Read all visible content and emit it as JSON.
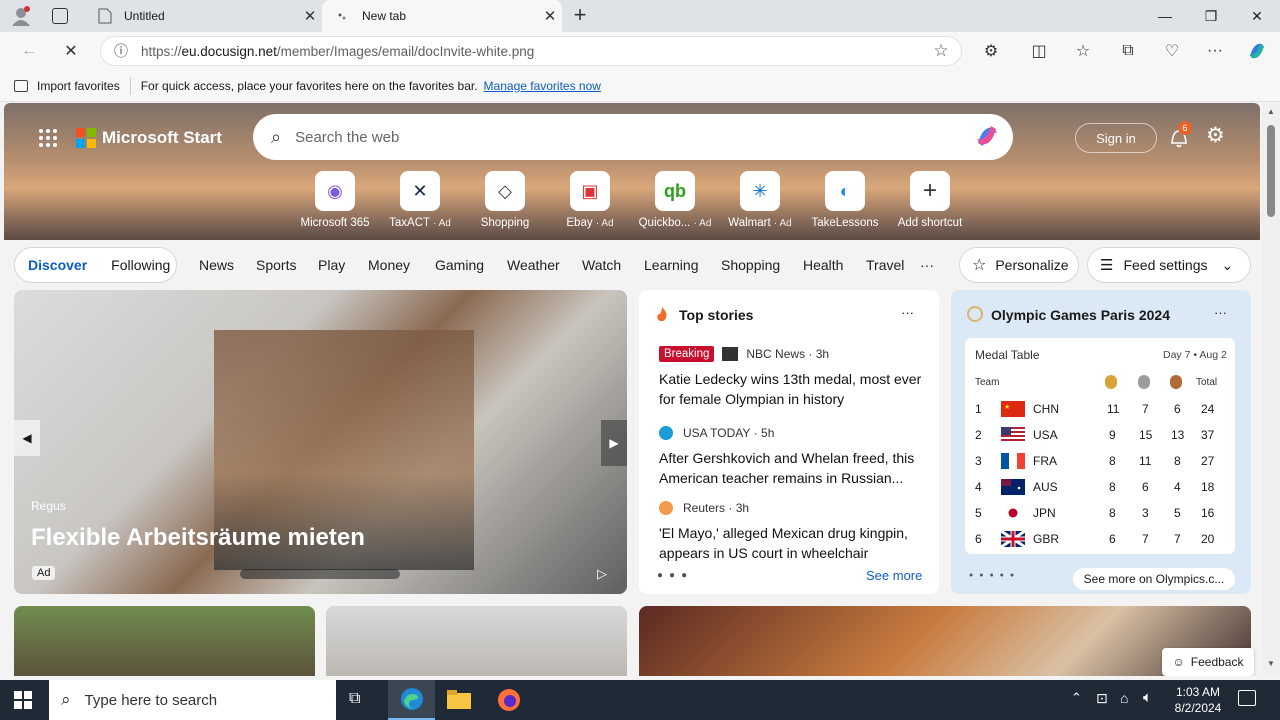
{
  "tabs": [
    {
      "label": "Untitled"
    },
    {
      "label": "New tab"
    }
  ],
  "address": {
    "host": "eu.docusign.net",
    "prefix": "https://",
    "path": "/member/Images/email/docInvite-white.png"
  },
  "favbar": {
    "import_label": "Import favorites",
    "hint": "For quick access, place your favorites here on the favorites bar.",
    "manage_link": "Manage favorites now"
  },
  "header": {
    "brand": "Microsoft Start",
    "search_placeholder": "Search the web",
    "sign_in": "Sign in",
    "notif_count": "6"
  },
  "shortcuts": [
    {
      "label": "Microsoft 365",
      "ad": "",
      "glyph": "◉",
      "color": "#7b5cd6"
    },
    {
      "label": "TaxACT",
      "ad": "· Ad",
      "glyph": "✕",
      "color": "#1b2a4a"
    },
    {
      "label": "Shopping",
      "ad": "",
      "glyph": "◇",
      "color": "#444"
    },
    {
      "label": "Ebay",
      "ad": "· Ad",
      "glyph": "▣",
      "color": "#e53238"
    },
    {
      "label": "Quickbo...",
      "ad": "· Ad",
      "glyph": "qb",
      "color": "#2ca01c"
    },
    {
      "label": "Walmart",
      "ad": "· Ad",
      "glyph": "✳",
      "color": "#0071dc"
    },
    {
      "label": "TakeLessons",
      "ad": "",
      "glyph": "◐",
      "color": "#2b8ed8"
    },
    {
      "label": "Add shortcut",
      "ad": "",
      "glyph": "+",
      "color": "#333"
    }
  ],
  "feed_tabs": {
    "discover": "Discover",
    "following": "Following"
  },
  "nav_links": [
    "News",
    "Sports",
    "Play",
    "Money",
    "Gaming",
    "Weather",
    "Watch",
    "Learning",
    "Shopping",
    "Health",
    "Travel"
  ],
  "more_glyph": "···",
  "buttons": {
    "personalize": "Personalize",
    "feed_settings": "Feed settings"
  },
  "hero_ad": {
    "source": "Regus",
    "title": "Flexible Arbeitsräume mieten",
    "ad_label": "Ad"
  },
  "top_stories": {
    "title": "Top stories",
    "see_more": "See more",
    "items": [
      {
        "badge": "Breaking",
        "source": "NBC News",
        "age": "3h",
        "headline": "Katie Ledecky wins 13th medal, most ever for female Olympian in history"
      },
      {
        "badge": "",
        "source": "USA TODAY",
        "age": "5h",
        "headline": "After Gershkovich and Whelan freed, this American teacher remains in Russian..."
      },
      {
        "badge": "",
        "source": "Reuters",
        "age": "3h",
        "headline": "'El Mayo,' alleged Mexican drug kingpin, appears in US court in wheelchair"
      }
    ]
  },
  "olympics": {
    "title": "Olympic Games Paris 2024",
    "table_title": "Medal Table",
    "day": "Day 7 • Aug 2",
    "col_team": "Team",
    "col_total": "Total",
    "see_more": "See more on Olympics.c...",
    "rows": [
      {
        "rank": "1",
        "team": "CHN",
        "gold": "11",
        "silver": "7",
        "bronze": "6",
        "total": "24"
      },
      {
        "rank": "2",
        "team": "USA",
        "gold": "9",
        "silver": "15",
        "bronze": "13",
        "total": "37"
      },
      {
        "rank": "3",
        "team": "FRA",
        "gold": "8",
        "silver": "11",
        "bronze": "8",
        "total": "27"
      },
      {
        "rank": "4",
        "team": "AUS",
        "gold": "8",
        "silver": "6",
        "bronze": "4",
        "total": "18"
      },
      {
        "rank": "5",
        "team": "JPN",
        "gold": "8",
        "silver": "3",
        "bronze": "5",
        "total": "16"
      },
      {
        "rank": "6",
        "team": "GBR",
        "gold": "6",
        "silver": "7",
        "bronze": "7",
        "total": "20"
      }
    ]
  },
  "feedback": "Feedback",
  "taskbar": {
    "search_placeholder": "Type here to search",
    "time": "1:03 AM",
    "date": "8/2/2024"
  }
}
